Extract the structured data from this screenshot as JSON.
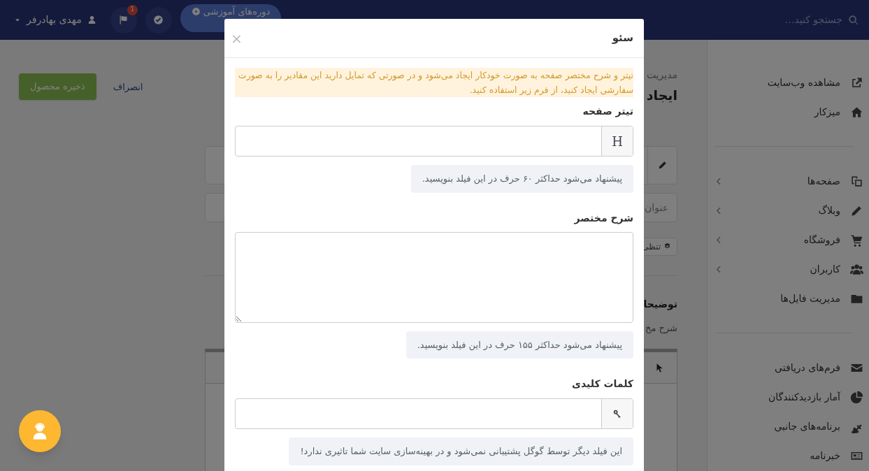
{
  "navbar": {
    "search_placeholder": "جستجو کنید...",
    "course_button": "دوره‌های آموزشی",
    "notification_count": "1",
    "user_name": "مهدی بهادرفر"
  },
  "sidebar": {
    "groups": [
      [
        {
          "label": "مشاهده وب‌سایت",
          "has_children": false
        },
        {
          "label": "میزکار",
          "has_children": false
        }
      ],
      [
        {
          "label": "صفحه‌ها",
          "has_children": true
        },
        {
          "label": "وبلاگ",
          "has_children": true
        },
        {
          "label": "فروشگاه",
          "has_children": true
        },
        {
          "label": "کاربران",
          "has_children": true
        },
        {
          "label": "مدیریت فایل‌ها",
          "has_children": false
        }
      ],
      [
        {
          "label": "فرم‌های دریافتی",
          "has_children": false
        },
        {
          "label": "آمار بازدیدکنندگان",
          "has_children": false
        },
        {
          "label": "برنامه‌های جانبی",
          "has_children": false
        },
        {
          "label": "خبرنامه",
          "has_children": false
        }
      ]
    ]
  },
  "page": {
    "breadcrumb": "مدیریت",
    "heading": "ایجاد",
    "save_button": "ذخیره محصول",
    "cancel_link": "انصراف",
    "title_placeholder": "عنوان",
    "settings_button": "تنظی",
    "section_title": "توضیحا",
    "section_subtitle": "شرح مخ"
  },
  "modal": {
    "title": "سئو",
    "close": "×",
    "notice": "تیتر و شرح مختصر صفحه به صورت خودکار ایجاد می‌شود و در صورتی که تمایل دارید این مقادیر را به صورت سفارشی ایجاد کنید، از فرم زیر استفاده کنید.",
    "fields": [
      {
        "label": "تیتر صفحه",
        "kind": "input",
        "addon": "H",
        "help": "پیشنهاد می‌شود حداکثر ۶۰ حرف در این فیلد بنویسید."
      },
      {
        "label": "شرح مختصر",
        "kind": "textarea",
        "help": "پیشنهاد می‌شود حداکثر ۱۵۵ حرف در این فیلد بنویسید."
      },
      {
        "label": "کلمات کلیدی",
        "kind": "input-key",
        "help": "این فیلد دیگر توسط گوگل پشتیبانی نمی‌شود و در بهینه‌سازی سایت شما تاثیری ندارد!"
      }
    ]
  }
}
